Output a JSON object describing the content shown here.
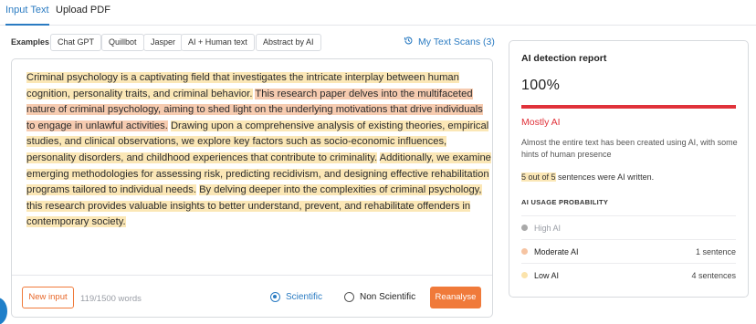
{
  "tabs": [
    {
      "label": "Input Text",
      "active": true
    },
    {
      "label": "Upload PDF",
      "active": false
    }
  ],
  "examples": {
    "label": "Examples",
    "chips": [
      "Chat GPT",
      "Quillbot",
      "Jasper",
      "AI + Human text",
      "Abstract by AI"
    ]
  },
  "scans": {
    "label": "My Text Scans (3)",
    "icon": "history-icon"
  },
  "editor": {
    "segments": [
      {
        "text": "Criminal psychology is a captivating field that investigates the intricate interplay between human cognition, personality traits, and criminal behavior.",
        "level": "low"
      },
      {
        "text": " ",
        "level": "none"
      },
      {
        "text": "This research paper delves into the multifaceted nature of criminal psychology, aiming to shed light on the underlying motivations that drive individuals to engage in unlawful activities.",
        "level": "moderate"
      },
      {
        "text": " ",
        "level": "none"
      },
      {
        "text": "Drawing upon a comprehensive analysis of existing theories, empirical studies, and clinical observations, we explore key factors such as socio-economic influences, personality disorders, and childhood experiences that contribute to criminality.",
        "level": "low"
      },
      {
        "text": " ",
        "level": "none"
      },
      {
        "text": "Additionally, we examine emerging methodologies for assessing risk, predicting recidivism, and designing effective rehabilitation programs tailored to individual needs.",
        "level": "low"
      },
      {
        "text": " ",
        "level": "none"
      },
      {
        "text": "By delving deeper into the complexities of criminal psychology, this research provides valuable insights to better understand, prevent, and rehabilitate offenders in contemporary society.",
        "level": "low"
      }
    ],
    "new_input_label": "New input",
    "word_count": "119/1500 words",
    "radio_scientific": "Scientific",
    "radio_non_scientific": "Non Scientific",
    "selected_mode": "Scientific",
    "reanalyse_label": "Reanalyse"
  },
  "report": {
    "title": "AI detection report",
    "percent": "100%",
    "percent_value": 1.0,
    "label": "Mostly AI",
    "description": "Almost the entire text has been created using AI, with some hints of human presence",
    "sentences_highlight": "5 out of 5",
    "sentences_rest": " sentences were AI written.",
    "usage_heading": "AI USAGE PROBABILITY",
    "rows": [
      {
        "name": "High AI",
        "count": "",
        "color": "#a9a9a9",
        "muted": true
      },
      {
        "name": "Moderate AI",
        "count": "1 sentence",
        "color": "#f6c4a2",
        "muted": false
      },
      {
        "name": "Low AI",
        "count": "4 sentences",
        "color": "#fbe3ab",
        "muted": false
      }
    ]
  },
  "colors": {
    "accent_blue": "#2a7bc2",
    "accent_orange": "#f07a3a",
    "ai_red": "#e0323a",
    "low_highlight": "#fbe7b6",
    "moderate_highlight": "#f6cbb0"
  }
}
